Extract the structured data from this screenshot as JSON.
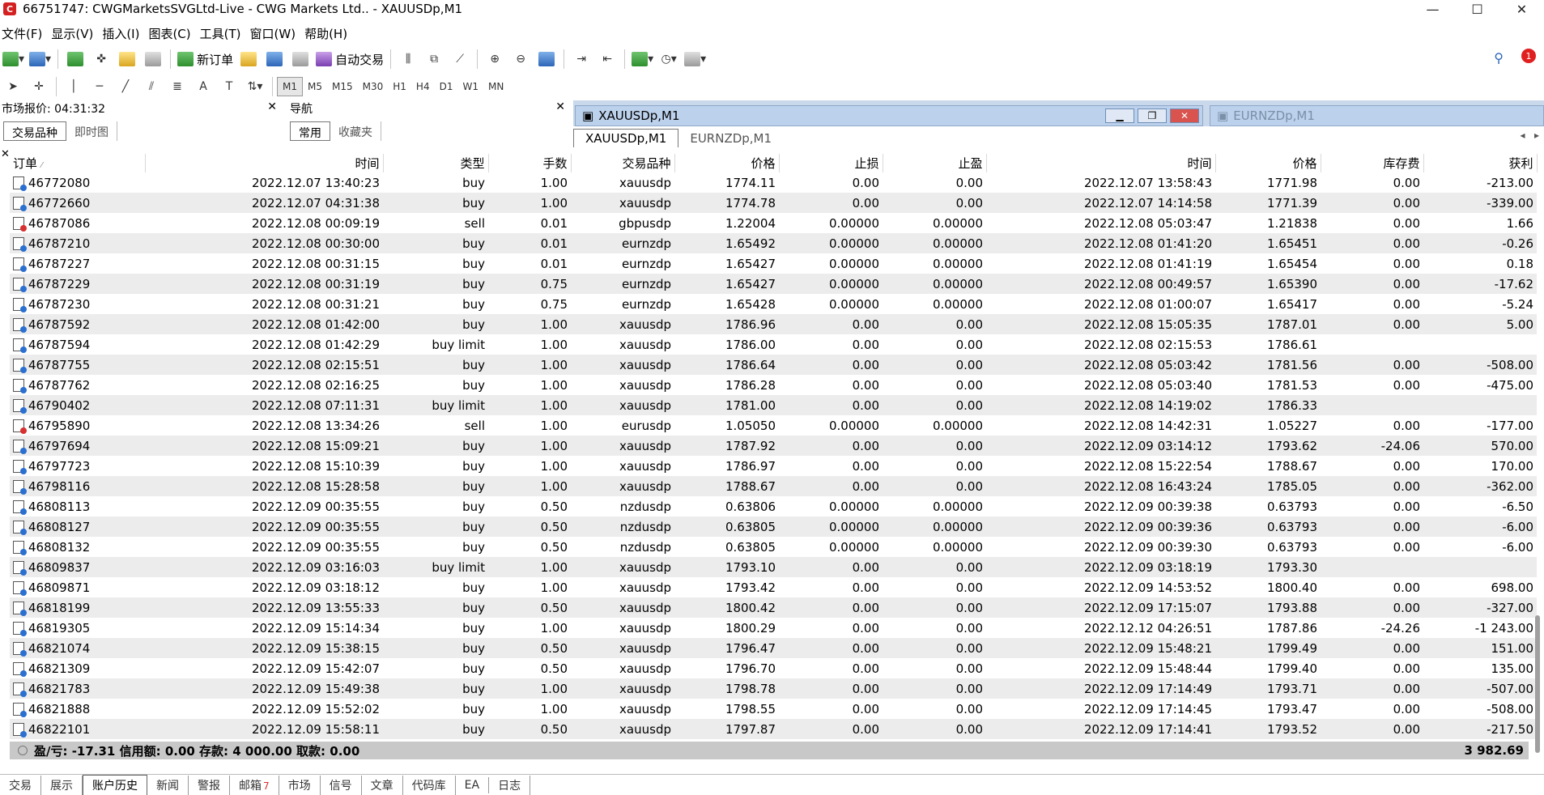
{
  "window": {
    "title": "66751747: CWGMarketsSVGLtd-Live - CWG Markets Ltd.. - XAUUSDp,M1",
    "app_icon": "C",
    "controls": [
      "—",
      "☐",
      "✕"
    ]
  },
  "menu": [
    "文件(F)",
    "显示(V)",
    "插入(I)",
    "图表(C)",
    "工具(T)",
    "窗口(W)",
    "帮助(H)"
  ],
  "toolbar": {
    "new_order": "新订单",
    "auto_trade": "自动交易",
    "notification_count": "1"
  },
  "periods": [
    "M1",
    "M5",
    "M15",
    "M30",
    "H1",
    "H4",
    "D1",
    "W1",
    "MN"
  ],
  "market_watch": {
    "title": "市场报价: 04:31:32",
    "tabs": [
      "交易品种",
      "即时图"
    ]
  },
  "navigator": {
    "title": "导航",
    "tabs": [
      "常用",
      "收藏夹"
    ]
  },
  "chart_windows": {
    "active_title": "XAUUSDp,M1",
    "inactive_title": "EURNZDp,M1",
    "tabs": [
      "XAUUSDp,M1",
      "EURNZDp,M1"
    ]
  },
  "history": {
    "columns": [
      "订单",
      "时间",
      "类型",
      "手数",
      "交易品种",
      "价格",
      "止损",
      "止盈",
      "时间",
      "价格",
      "库存费",
      "获利"
    ],
    "rows": [
      [
        "46772080",
        "2022.12.07 13:40:23",
        "buy",
        "1.00",
        "xauusdp",
        "1774.11",
        "0.00",
        "0.00",
        "2022.12.07 13:58:43",
        "1771.98",
        "0.00",
        "-213.00"
      ],
      [
        "46772660",
        "2022.12.07 04:31:38",
        "buy",
        "1.00",
        "xauusdp",
        "1774.78",
        "0.00",
        "0.00",
        "2022.12.07 14:14:58",
        "1771.39",
        "0.00",
        "-339.00"
      ],
      [
        "46787086",
        "2022.12.08 00:09:19",
        "sell",
        "0.01",
        "gbpusdp",
        "1.22004",
        "0.00000",
        "0.00000",
        "2022.12.08 05:03:47",
        "1.21838",
        "0.00",
        "1.66"
      ],
      [
        "46787210",
        "2022.12.08 00:30:00",
        "buy",
        "0.01",
        "eurnzdp",
        "1.65492",
        "0.00000",
        "0.00000",
        "2022.12.08 01:41:20",
        "1.65451",
        "0.00",
        "-0.26"
      ],
      [
        "46787227",
        "2022.12.08 00:31:15",
        "buy",
        "0.01",
        "eurnzdp",
        "1.65427",
        "0.00000",
        "0.00000",
        "2022.12.08 01:41:19",
        "1.65454",
        "0.00",
        "0.18"
      ],
      [
        "46787229",
        "2022.12.08 00:31:19",
        "buy",
        "0.75",
        "eurnzdp",
        "1.65427",
        "0.00000",
        "0.00000",
        "2022.12.08 00:49:57",
        "1.65390",
        "0.00",
        "-17.62"
      ],
      [
        "46787230",
        "2022.12.08 00:31:21",
        "buy",
        "0.75",
        "eurnzdp",
        "1.65428",
        "0.00000",
        "0.00000",
        "2022.12.08 01:00:07",
        "1.65417",
        "0.00",
        "-5.24"
      ],
      [
        "46787592",
        "2022.12.08 01:42:00",
        "buy",
        "1.00",
        "xauusdp",
        "1786.96",
        "0.00",
        "0.00",
        "2022.12.08 15:05:35",
        "1787.01",
        "0.00",
        "5.00"
      ],
      [
        "46787594",
        "2022.12.08 01:42:29",
        "buy limit",
        "1.00",
        "xauusdp",
        "1786.00",
        "0.00",
        "0.00",
        "2022.12.08 02:15:53",
        "1786.61",
        "",
        ""
      ],
      [
        "46787755",
        "2022.12.08 02:15:51",
        "buy",
        "1.00",
        "xauusdp",
        "1786.64",
        "0.00",
        "0.00",
        "2022.12.08 05:03:42",
        "1781.56",
        "0.00",
        "-508.00"
      ],
      [
        "46787762",
        "2022.12.08 02:16:25",
        "buy",
        "1.00",
        "xauusdp",
        "1786.28",
        "0.00",
        "0.00",
        "2022.12.08 05:03:40",
        "1781.53",
        "0.00",
        "-475.00"
      ],
      [
        "46790402",
        "2022.12.08 07:11:31",
        "buy limit",
        "1.00",
        "xauusdp",
        "1781.00",
        "0.00",
        "0.00",
        "2022.12.08 14:19:02",
        "1786.33",
        "",
        ""
      ],
      [
        "46795890",
        "2022.12.08 13:34:26",
        "sell",
        "1.00",
        "eurusdp",
        "1.05050",
        "0.00000",
        "0.00000",
        "2022.12.08 14:42:31",
        "1.05227",
        "0.00",
        "-177.00"
      ],
      [
        "46797694",
        "2022.12.08 15:09:21",
        "buy",
        "1.00",
        "xauusdp",
        "1787.92",
        "0.00",
        "0.00",
        "2022.12.09 03:14:12",
        "1793.62",
        "-24.06",
        "570.00"
      ],
      [
        "46797723",
        "2022.12.08 15:10:39",
        "buy",
        "1.00",
        "xauusdp",
        "1786.97",
        "0.00",
        "0.00",
        "2022.12.08 15:22:54",
        "1788.67",
        "0.00",
        "170.00"
      ],
      [
        "46798116",
        "2022.12.08 15:28:58",
        "buy",
        "1.00",
        "xauusdp",
        "1788.67",
        "0.00",
        "0.00",
        "2022.12.08 16:43:24",
        "1785.05",
        "0.00",
        "-362.00"
      ],
      [
        "46808113",
        "2022.12.09 00:35:55",
        "buy",
        "0.50",
        "nzdusdp",
        "0.63806",
        "0.00000",
        "0.00000",
        "2022.12.09 00:39:38",
        "0.63793",
        "0.00",
        "-6.50"
      ],
      [
        "46808127",
        "2022.12.09 00:35:55",
        "buy",
        "0.50",
        "nzdusdp",
        "0.63805",
        "0.00000",
        "0.00000",
        "2022.12.09 00:39:36",
        "0.63793",
        "0.00",
        "-6.00"
      ],
      [
        "46808132",
        "2022.12.09 00:35:55",
        "buy",
        "0.50",
        "nzdusdp",
        "0.63805",
        "0.00000",
        "0.00000",
        "2022.12.09 00:39:30",
        "0.63793",
        "0.00",
        "-6.00"
      ],
      [
        "46809837",
        "2022.12.09 03:16:03",
        "buy limit",
        "1.00",
        "xauusdp",
        "1793.10",
        "0.00",
        "0.00",
        "2022.12.09 03:18:19",
        "1793.30",
        "",
        ""
      ],
      [
        "46809871",
        "2022.12.09 03:18:12",
        "buy",
        "1.00",
        "xauusdp",
        "1793.42",
        "0.00",
        "0.00",
        "2022.12.09 14:53:52",
        "1800.40",
        "0.00",
        "698.00"
      ],
      [
        "46818199",
        "2022.12.09 13:55:33",
        "buy",
        "0.50",
        "xauusdp",
        "1800.42",
        "0.00",
        "0.00",
        "2022.12.09 17:15:07",
        "1793.88",
        "0.00",
        "-327.00"
      ],
      [
        "46819305",
        "2022.12.09 15:14:34",
        "buy",
        "1.00",
        "xauusdp",
        "1800.29",
        "0.00",
        "0.00",
        "2022.12.12 04:26:51",
        "1787.86",
        "-24.26",
        "-1 243.00"
      ],
      [
        "46821074",
        "2022.12.09 15:38:15",
        "buy",
        "0.50",
        "xauusdp",
        "1796.47",
        "0.00",
        "0.00",
        "2022.12.09 15:48:21",
        "1799.49",
        "0.00",
        "151.00"
      ],
      [
        "46821309",
        "2022.12.09 15:42:07",
        "buy",
        "0.50",
        "xauusdp",
        "1796.70",
        "0.00",
        "0.00",
        "2022.12.09 15:48:44",
        "1799.40",
        "0.00",
        "135.00"
      ],
      [
        "46821783",
        "2022.12.09 15:49:38",
        "buy",
        "1.00",
        "xauusdp",
        "1798.78",
        "0.00",
        "0.00",
        "2022.12.09 17:14:49",
        "1793.71",
        "0.00",
        "-507.00"
      ],
      [
        "46821888",
        "2022.12.09 15:52:02",
        "buy",
        "1.00",
        "xauusdp",
        "1798.55",
        "0.00",
        "0.00",
        "2022.12.09 17:14:45",
        "1793.47",
        "0.00",
        "-508.00"
      ],
      [
        "46822101",
        "2022.12.09 15:58:11",
        "buy",
        "0.50",
        "xauusdp",
        "1797.87",
        "0.00",
        "0.00",
        "2022.12.09 17:14:41",
        "1793.52",
        "0.00",
        "-217.50"
      ]
    ],
    "summary": "盈/亏: -17.31  信用额: 0.00  存款: 4 000.00  取款: 0.00",
    "total": "3 982.69"
  },
  "bottom_tabs": [
    {
      "label": "交易",
      "badge": ""
    },
    {
      "label": "展示",
      "badge": ""
    },
    {
      "label": "账户历史",
      "badge": ""
    },
    {
      "label": "新闻",
      "badge": ""
    },
    {
      "label": "警报",
      "badge": ""
    },
    {
      "label": "邮箱",
      "badge": "7"
    },
    {
      "label": "市场",
      "badge": ""
    },
    {
      "label": "信号",
      "badge": ""
    },
    {
      "label": "文章",
      "badge": ""
    },
    {
      "label": "代码库",
      "badge": ""
    },
    {
      "label": "EA",
      "badge": ""
    },
    {
      "label": "日志",
      "badge": ""
    }
  ],
  "active_bottom_tab": "账户历史"
}
